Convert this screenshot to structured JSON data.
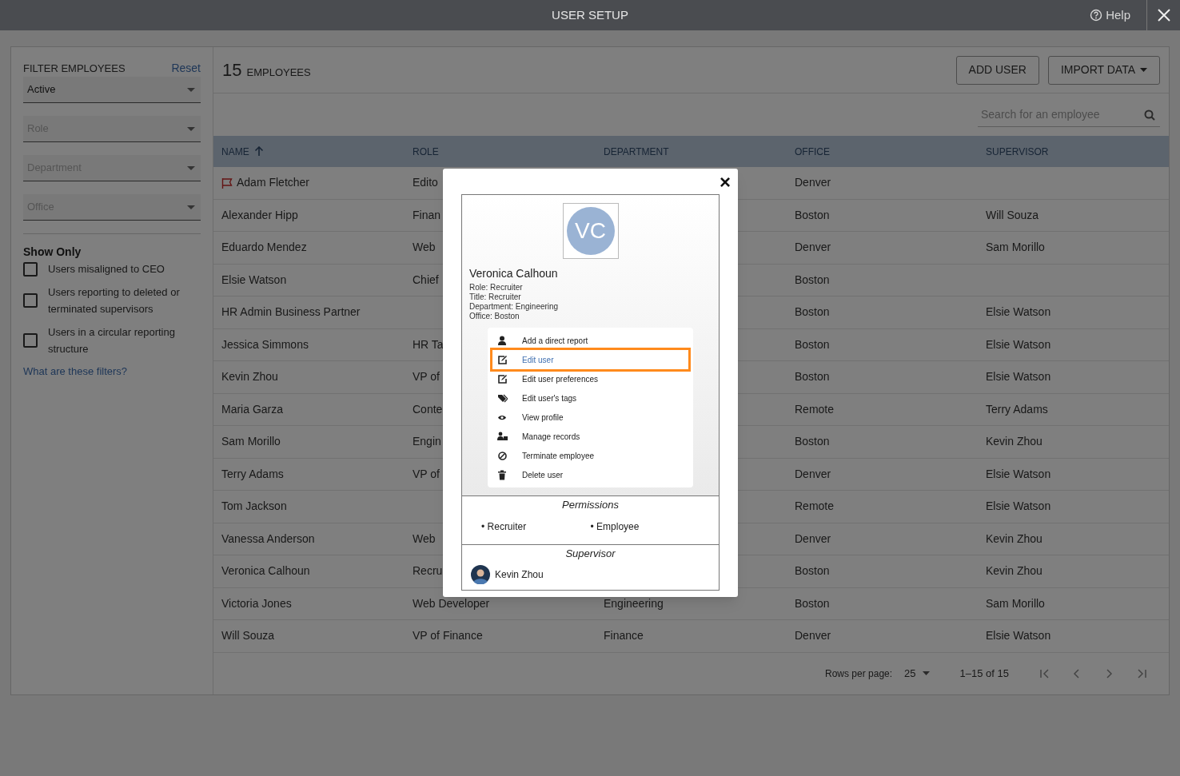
{
  "window": {
    "title": "USER SETUP",
    "help": "Help"
  },
  "sidebar": {
    "title": "FILTER EMPLOYEES",
    "reset": "Reset",
    "dropdowns": [
      {
        "value": "Active"
      },
      {
        "placeholder": "Role"
      },
      {
        "placeholder": "Department"
      },
      {
        "placeholder": "Office"
      }
    ],
    "show_only_title": "Show Only",
    "checkboxes": [
      {
        "label": "Users misaligned to CEO",
        "checked": false
      },
      {
        "label": "Users reporting to deleted or terminated supervisors",
        "checked": false
      },
      {
        "label": "Users in a circular reporting structure",
        "checked": false
      }
    ],
    "link": "What are these filters?"
  },
  "main": {
    "count": "15",
    "count_label": "EMPLOYEES",
    "buttons": [
      {
        "label": "ADD USER",
        "dropdown": false
      },
      {
        "label": "IMPORT DATA",
        "dropdown": true
      }
    ],
    "search": {
      "placeholder": "Search for an employee"
    },
    "columns": [
      {
        "label": "NAME",
        "sorted": true
      },
      {
        "label": "ROLE",
        "sorted": false
      },
      {
        "label": "DEPARTMENT",
        "sorted": false
      },
      {
        "label": "OFFICE",
        "sorted": false
      },
      {
        "label": "SUPERVISOR",
        "sorted": false
      }
    ],
    "rows": [
      {
        "name": "Adam Fletcher",
        "flagged": true,
        "role": "Edito",
        "office": "Denver"
      },
      {
        "name": "Alexander Hipp",
        "flagged": false,
        "role": "Finan",
        "office": "Boston",
        "supervisor": "Will Souza"
      },
      {
        "name": "Eduardo Mendez",
        "flagged": false,
        "role": "Web",
        "office": "Denver",
        "supervisor": "Sam Morillo"
      },
      {
        "name": "Elsie Watson",
        "flagged": false,
        "role": "Chief",
        "office": "Boston"
      },
      {
        "name": "HR Admin Business Partner",
        "flagged": false,
        "office": "Boston",
        "supervisor": "Elsie Watson"
      },
      {
        "name": "Jessica Simmons",
        "flagged": false,
        "role": "HR Ta",
        "office": "Boston",
        "supervisor": "Elsie Watson"
      },
      {
        "name": "Kevin Zhou",
        "flagged": false,
        "role": "VP of",
        "office": "Boston",
        "supervisor": "Elsie Watson"
      },
      {
        "name": "Maria Garza",
        "flagged": false,
        "role": "Conte",
        "office": "Remote",
        "supervisor": "Terry Adams"
      },
      {
        "name": "Sam Morillo",
        "flagged": false,
        "role": "Engin",
        "office": "Boston",
        "supervisor": "Kevin Zhou"
      },
      {
        "name": "Terry Adams",
        "flagged": false,
        "role": "VP of",
        "office": "Denver",
        "supervisor": "Elsie Watson"
      },
      {
        "name": "Tom Jackson",
        "flagged": false,
        "office": "Remote",
        "supervisor": "Elsie Watson"
      },
      {
        "name": "Vanessa Anderson",
        "flagged": false,
        "role": "Web",
        "office": "Denver",
        "supervisor": "Kevin Zhou"
      },
      {
        "name": "Veronica Calhoun",
        "flagged": false,
        "role": "Recru",
        "office": "Boston",
        "supervisor": "Kevin Zhou"
      },
      {
        "name": "Victoria Jones",
        "flagged": false,
        "role": "Web Developer",
        "department": "Engineering",
        "office": "Boston",
        "supervisor": "Sam Morillo"
      },
      {
        "name": "Will Souza",
        "flagged": false,
        "role": "VP of Finance",
        "department": "Finance",
        "office": "Denver",
        "supervisor": "Elsie Watson"
      }
    ],
    "pagination": {
      "rows_label": "Rows per page:",
      "rows_value": "25",
      "range": "1–15 of 15"
    }
  },
  "modal": {
    "close": "×",
    "initials": "VC",
    "name": "Veronica Calhoun",
    "details": [
      "Role: Recruiter",
      "Title: Recruiter",
      "Department: Engineering",
      "Office: Boston"
    ],
    "menu": [
      {
        "label": "Add a direct report",
        "highlighted": false
      },
      {
        "label": "Edit user",
        "highlighted": true
      },
      {
        "label": "Edit user preferences",
        "highlighted": false
      },
      {
        "label": "Edit user's tags",
        "highlighted": false
      },
      {
        "label": "View profile",
        "highlighted": false
      },
      {
        "label": "Manage records",
        "highlighted": false
      },
      {
        "label": "Terminate employee",
        "highlighted": false
      },
      {
        "label": "Delete user",
        "highlighted": false
      }
    ],
    "permissions_title": "Permissions",
    "permissions": [
      "• Recruiter",
      "• Employee"
    ],
    "supervisor_title": "Supervisor",
    "supervisor": "Kevin Zhou"
  }
}
